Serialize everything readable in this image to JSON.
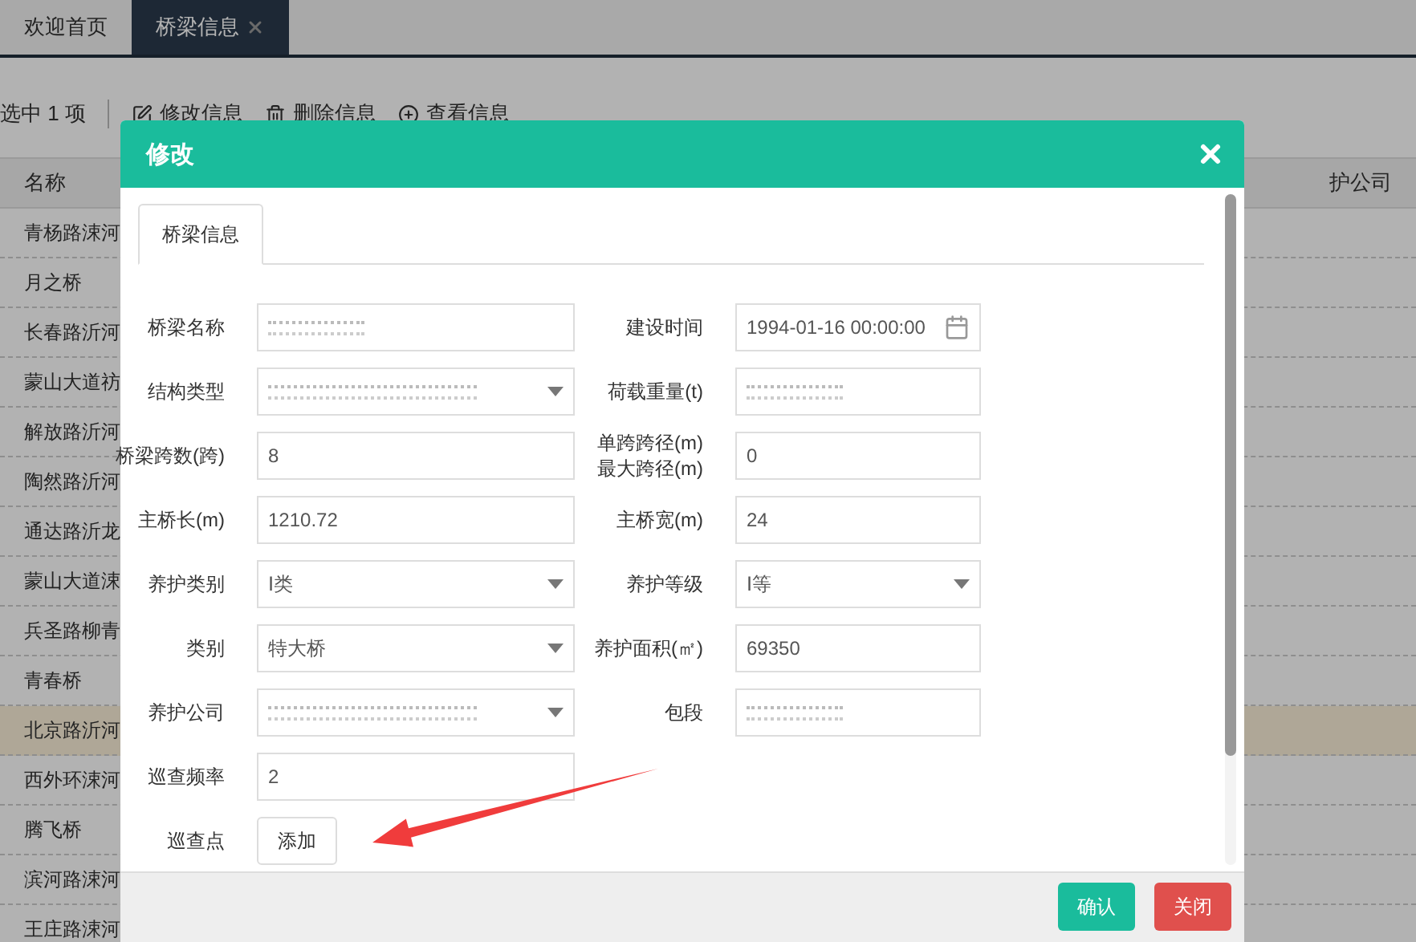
{
  "top_tabs": [
    {
      "label": "欢迎首页",
      "selected": false,
      "closable": false
    },
    {
      "label": "桥梁信息",
      "selected": true,
      "closable": true
    }
  ],
  "toolbar": {
    "selection": "选中 1 项",
    "actions": [
      {
        "label": "修改信息",
        "kind": "edit"
      },
      {
        "label": "删除信息",
        "kind": "delete"
      },
      {
        "label": "查看信息",
        "kind": "view"
      }
    ]
  },
  "table": {
    "columns": [
      "名称",
      "护公司"
    ],
    "rows": [
      {
        "name": "青杨路涑河",
        "selected": false
      },
      {
        "name": "月之桥",
        "selected": false
      },
      {
        "name": "长春路沂河",
        "selected": false
      },
      {
        "name": "蒙山大道祊",
        "selected": false
      },
      {
        "name": "解放路沂河",
        "selected": false
      },
      {
        "name": "陶然路沂河",
        "selected": false
      },
      {
        "name": "通达路沂龙",
        "selected": false
      },
      {
        "name": "蒙山大道涑",
        "selected": false
      },
      {
        "name": "兵圣路柳青",
        "selected": false
      },
      {
        "name": "青春桥",
        "selected": false
      },
      {
        "name": "北京路沂河",
        "selected": true
      },
      {
        "name": "西外环涑河",
        "selected": false
      },
      {
        "name": "腾飞桥",
        "selected": false
      },
      {
        "name": "滨河路涑河",
        "selected": false
      },
      {
        "name": "王庄路涑河",
        "selected": false
      }
    ]
  },
  "dialog": {
    "title": "修改",
    "tabs": [
      {
        "label": "桥梁信息",
        "selected": true
      }
    ],
    "rows": [
      {
        "fields": [
          {
            "label": "桥梁名称",
            "kind": "text",
            "redacted": true
          },
          {
            "label": "建设时间",
            "kind": "date",
            "value": "1994-01-16 00:00:00"
          }
        ]
      },
      {
        "fields": [
          {
            "label": "结构类型",
            "kind": "select",
            "redacted": true
          },
          {
            "label": "荷载重量(t)",
            "kind": "text",
            "redacted": true
          }
        ]
      },
      {
        "fields": [
          {
            "label": "桥梁跨数(跨)",
            "kind": "text",
            "value": "8"
          },
          {
            "label": "单跨跨径(m)\n最大跨径(m)",
            "kind": "text",
            "value": "0"
          }
        ]
      },
      {
        "fields": [
          {
            "label": "主桥长(m)",
            "kind": "text",
            "value": "1210.72"
          },
          {
            "label": "主桥宽(m)",
            "kind": "text",
            "value": "24"
          }
        ]
      },
      {
        "fields": [
          {
            "label": "养护类别",
            "kind": "select",
            "value": "Ⅰ类"
          },
          {
            "label": "养护等级",
            "kind": "select",
            "value": "Ⅰ等"
          }
        ]
      },
      {
        "fields": [
          {
            "label": "类别",
            "kind": "select",
            "value": "特大桥"
          },
          {
            "label": "养护面积(㎡)",
            "kind": "text",
            "value": "69350"
          }
        ]
      },
      {
        "fields": [
          {
            "label": "养护公司",
            "kind": "select",
            "redacted": true
          },
          {
            "label": "包段",
            "kind": "text",
            "redacted": true
          }
        ]
      },
      {
        "fields": [
          {
            "label": "巡查频率",
            "kind": "text",
            "value": "2"
          }
        ]
      },
      {
        "fields": [
          {
            "label": "巡查点",
            "kind": "button",
            "value": "添加"
          }
        ]
      }
    ],
    "buttons": [
      {
        "label": "确认",
        "kind": "primary"
      },
      {
        "label": "关闭",
        "kind": "danger"
      }
    ]
  }
}
